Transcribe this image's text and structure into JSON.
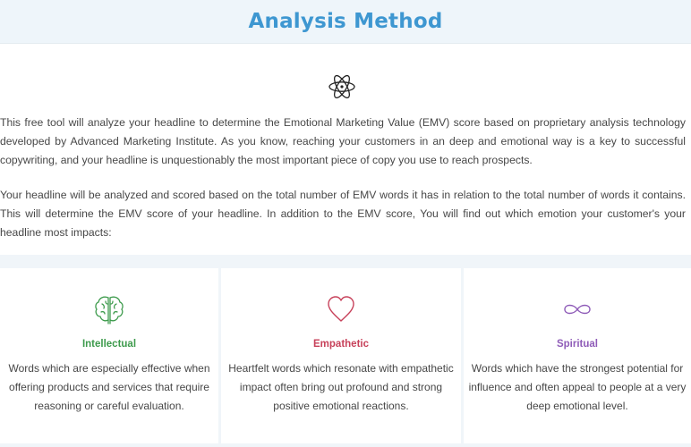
{
  "header": {
    "title": "Analysis Method"
  },
  "intro": {
    "icon": "atom-icon",
    "paragraph1": "This free tool will analyze your headline to determine the Emotional Marketing Value (EMV) score based on proprietary analysis technology developed by Advanced Marketing Institute. As you know, reaching your customers in an deep and emotional way is a key to successful copywriting, and your headline is unquestionably the most important piece of copy you use to reach prospects.",
    "paragraph2": "Your headline will be analyzed and scored based on the total number of EMV words it has in relation to the total number of words it contains. This will determine the EMV score of your headline.  In addition to the EMV score, You will find out which emotion your customer's your headline most impacts:"
  },
  "categories": [
    {
      "icon": "brain-icon",
      "title": "Intellectual",
      "description": "Words which are especially effective when offering products and services that require reasoning or careful evaluation.",
      "color": "#3e9b4d"
    },
    {
      "icon": "heart-icon",
      "title": "Empathetic",
      "description": "Heartfelt words which resonate with empathetic impact often bring out profound and strong positive emotional reactions.",
      "color": "#c7415a"
    },
    {
      "icon": "infinity-icon",
      "title": "Spiritual",
      "description": "Words which have the strongest potential for influence and often appeal to people at a very deep emotional level.",
      "color": "#8f5cb8"
    }
  ],
  "colors": {
    "header_bg": "#eef5fa",
    "title": "#3e97d1",
    "band_bg": "#f0f5f9"
  }
}
